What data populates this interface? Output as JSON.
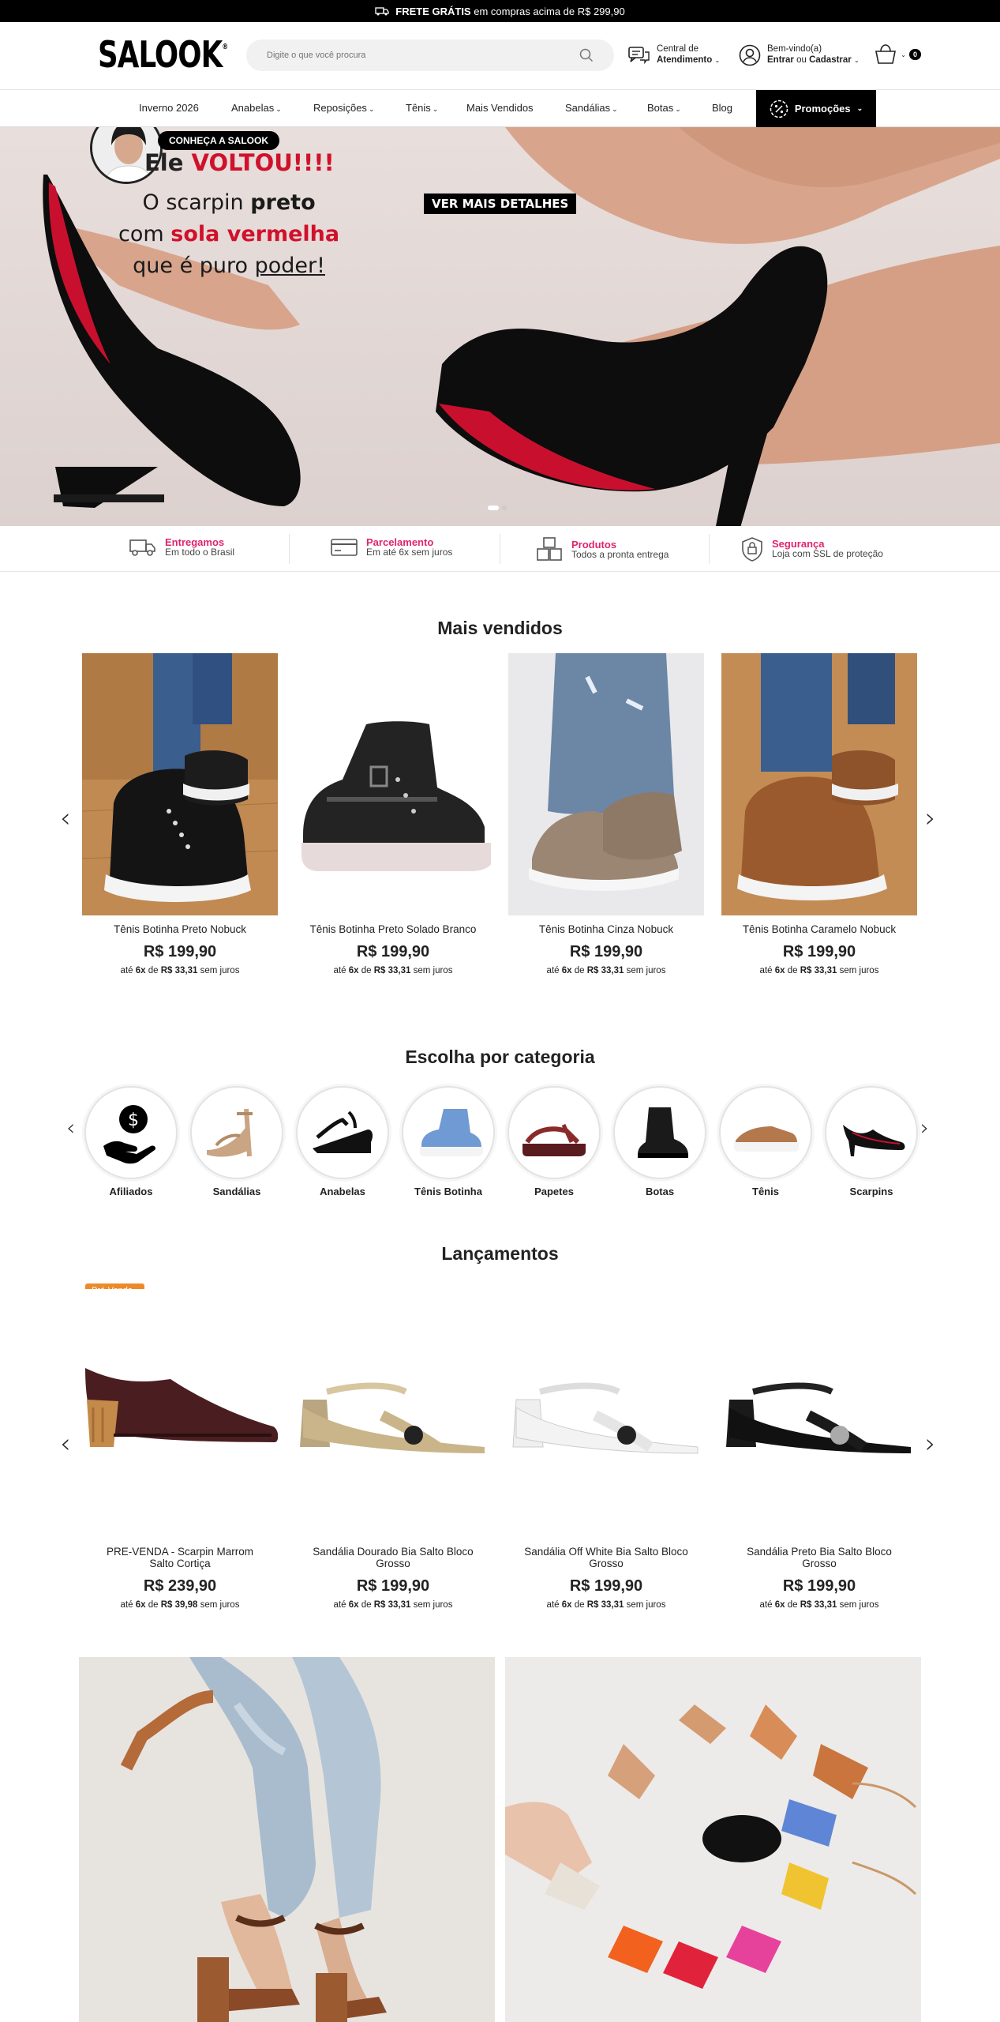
{
  "topbar": {
    "bold": "FRETE GRÁTIS",
    "text": "em compras acima de R$ 299,90"
  },
  "header": {
    "logo": "SALOOK",
    "search_placeholder": "Digite o que você procura",
    "support_line1": "Central de",
    "support_line2": "Atendimento",
    "account_line1": "Bem-vindo(a)",
    "account_login": "Entrar",
    "account_or": "ou",
    "account_register": "Cadastrar",
    "cart_count": "0"
  },
  "nav": {
    "items": [
      "Inverno 2026",
      "Anabelas",
      "Reposições",
      "Tênis",
      "Mais Vendidos",
      "Sandálias",
      "Botas",
      "Blog"
    ],
    "promo": "Promoções"
  },
  "hero": {
    "title_prefix": "Ele ",
    "title_red": "VOLTOU!!!!",
    "line1_a": "O scarpin ",
    "line1_b": "preto",
    "line2_a": "com ",
    "line2_b": "sola vermelha",
    "line3_a": "que é puro ",
    "line3_b": "poder!",
    "button": "VER MAIS DETALHES",
    "bubble_label": "CONHEÇA A SALOOK"
  },
  "benefits": [
    {
      "title": "Entregamos",
      "sub": "Em todo o Brasil",
      "icon": "truck-icon"
    },
    {
      "title": "Parcelamento",
      "sub": "Em até 6x sem juros",
      "icon": "credit-card-icon"
    },
    {
      "title": "Produtos",
      "sub": "Todos a pronta entrega",
      "icon": "boxes-icon"
    },
    {
      "title": "Segurança",
      "sub": "Loja com SSL de proteção",
      "icon": "lock-shield-icon"
    }
  ],
  "best_sellers": {
    "title": "Mais vendidos",
    "items": [
      {
        "name": "Tênis Botinha Preto Nobuck",
        "price": "R$ 199,90",
        "inst_a": "até ",
        "inst_n": "6x",
        "inst_b": " de ",
        "inst_v": "R$ 33,31",
        "inst_c": " sem juros"
      },
      {
        "name": "Tênis Botinha Preto Solado Branco",
        "price": "R$ 199,90",
        "inst_a": "até ",
        "inst_n": "6x",
        "inst_b": " de ",
        "inst_v": "R$ 33,31",
        "inst_c": " sem juros"
      },
      {
        "name": "Tênis Botinha Cinza Nobuck",
        "price": "R$ 199,90",
        "inst_a": "até ",
        "inst_n": "6x",
        "inst_b": " de ",
        "inst_v": "R$ 33,31",
        "inst_c": " sem juros"
      },
      {
        "name": "Tênis Botinha Caramelo Nobuck",
        "price": "R$ 199,90",
        "inst_a": "até ",
        "inst_n": "6x",
        "inst_b": " de ",
        "inst_v": "R$ 33,31",
        "inst_c": " sem juros"
      }
    ]
  },
  "categories": {
    "title": "Escolha por categoria",
    "items": [
      "Afiliados",
      "Sandálias",
      "Anabelas",
      "Tênis Botinha",
      "Papetes",
      "Botas",
      "Tênis",
      "Scarpins"
    ]
  },
  "launches": {
    "title": "Lançamentos",
    "badge": "Pré-Venda -",
    "items": [
      {
        "name": "PRE-VENDA - Scarpin Marrom Salto Cortiça",
        "price": "R$ 239,90",
        "inst_a": "até ",
        "inst_n": "6x",
        "inst_b": " de ",
        "inst_v": "R$ 39,98",
        "inst_c": " sem juros"
      },
      {
        "name": "Sandália Dourado Bia Salto Bloco Grosso",
        "price": "R$ 199,90",
        "inst_a": "até ",
        "inst_n": "6x",
        "inst_b": " de ",
        "inst_v": "R$ 33,31",
        "inst_c": " sem juros"
      },
      {
        "name": "Sandália Off White Bia Salto Bloco Grosso",
        "price": "R$ 199,90",
        "inst_a": "até ",
        "inst_n": "6x",
        "inst_b": " de ",
        "inst_v": "R$ 33,31",
        "inst_c": " sem juros"
      },
      {
        "name": "Sandália Preto Bia Salto Bloco Grosso",
        "price": "R$ 199,90",
        "inst_a": "até ",
        "inst_n": "6x",
        "inst_b": " de ",
        "inst_v": "R$ 33,31",
        "inst_c": " sem juros"
      }
    ]
  }
}
